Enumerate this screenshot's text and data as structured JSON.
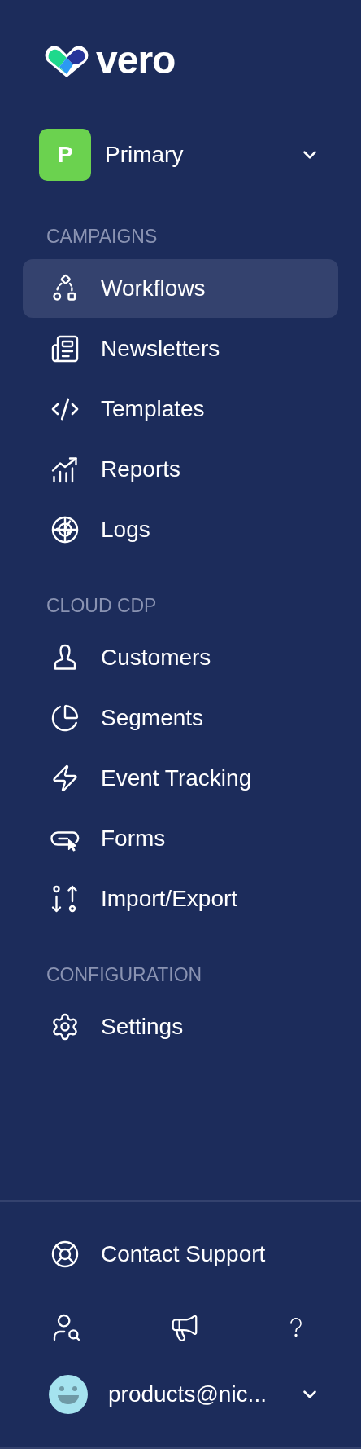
{
  "logo": {
    "text": "vero"
  },
  "workspace": {
    "initial": "P",
    "name": "Primary",
    "color": "#6bd24f"
  },
  "sections": [
    {
      "title": "CAMPAIGNS",
      "items": [
        {
          "label": "Workflows",
          "selected": true
        },
        {
          "label": "Newsletters",
          "selected": false
        },
        {
          "label": "Templates",
          "selected": false
        },
        {
          "label": "Reports",
          "selected": false
        },
        {
          "label": "Logs",
          "selected": false
        }
      ]
    },
    {
      "title": "CLOUD CDP",
      "items": [
        {
          "label": "Customers",
          "selected": false
        },
        {
          "label": "Segments",
          "selected": false
        },
        {
          "label": "Event Tracking",
          "selected": false
        },
        {
          "label": "Forms",
          "selected": false
        },
        {
          "label": "Import/Export",
          "selected": false
        }
      ]
    },
    {
      "title": "CONFIGURATION",
      "items": [
        {
          "label": "Settings",
          "selected": false
        }
      ]
    }
  ],
  "footer": {
    "contact": {
      "label": "Contact Support"
    },
    "user": {
      "email": "products@nic..."
    }
  }
}
